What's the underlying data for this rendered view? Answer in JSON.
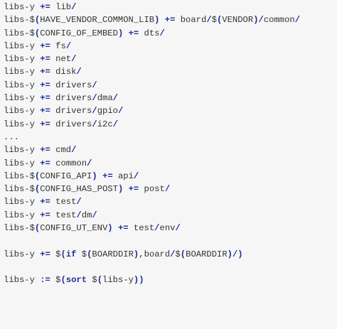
{
  "editor": {
    "lines": [
      {
        "tokens": [
          {
            "t": "libs-y ",
            "c": "tx"
          },
          {
            "t": "+=",
            "c": "op"
          },
          {
            "t": " lib",
            "c": "tx"
          },
          {
            "t": "/",
            "c": "sl"
          }
        ]
      },
      {
        "tokens": [
          {
            "t": "libs-$",
            "c": "tx"
          },
          {
            "t": "(",
            "c": "kw"
          },
          {
            "t": "HAVE_VENDOR_COMMON_LIB",
            "c": "tx"
          },
          {
            "t": ")",
            "c": "kw"
          },
          {
            "t": " ",
            "c": "tx"
          },
          {
            "t": "+=",
            "c": "op"
          },
          {
            "t": " board",
            "c": "tx"
          },
          {
            "t": "/",
            "c": "sl"
          },
          {
            "t": "$",
            "c": "tx"
          },
          {
            "t": "(",
            "c": "kw"
          },
          {
            "t": "VENDOR",
            "c": "tx"
          },
          {
            "t": ")",
            "c": "kw"
          },
          {
            "t": "/",
            "c": "sl"
          },
          {
            "t": "common",
            "c": "tx"
          },
          {
            "t": "/",
            "c": "sl"
          }
        ]
      },
      {
        "tokens": [
          {
            "t": "libs-$",
            "c": "tx"
          },
          {
            "t": "(",
            "c": "kw"
          },
          {
            "t": "CONFIG_OF_EMBED",
            "c": "tx"
          },
          {
            "t": ")",
            "c": "kw"
          },
          {
            "t": " ",
            "c": "tx"
          },
          {
            "t": "+=",
            "c": "op"
          },
          {
            "t": " dts",
            "c": "tx"
          },
          {
            "t": "/",
            "c": "sl"
          }
        ]
      },
      {
        "tokens": [
          {
            "t": "libs-y ",
            "c": "tx"
          },
          {
            "t": "+=",
            "c": "op"
          },
          {
            "t": " fs",
            "c": "tx"
          },
          {
            "t": "/",
            "c": "sl"
          }
        ]
      },
      {
        "tokens": [
          {
            "t": "libs-y ",
            "c": "tx"
          },
          {
            "t": "+=",
            "c": "op"
          },
          {
            "t": " net",
            "c": "tx"
          },
          {
            "t": "/",
            "c": "sl"
          }
        ]
      },
      {
        "tokens": [
          {
            "t": "libs-y ",
            "c": "tx"
          },
          {
            "t": "+=",
            "c": "op"
          },
          {
            "t": " disk",
            "c": "tx"
          },
          {
            "t": "/",
            "c": "sl"
          }
        ]
      },
      {
        "tokens": [
          {
            "t": "libs-y ",
            "c": "tx"
          },
          {
            "t": "+=",
            "c": "op"
          },
          {
            "t": " drivers",
            "c": "tx"
          },
          {
            "t": "/",
            "c": "sl"
          }
        ]
      },
      {
        "tokens": [
          {
            "t": "libs-y ",
            "c": "tx"
          },
          {
            "t": "+=",
            "c": "op"
          },
          {
            "t": " drivers",
            "c": "tx"
          },
          {
            "t": "/",
            "c": "sl"
          },
          {
            "t": "dma",
            "c": "tx"
          },
          {
            "t": "/",
            "c": "sl"
          }
        ]
      },
      {
        "tokens": [
          {
            "t": "libs-y ",
            "c": "tx"
          },
          {
            "t": "+=",
            "c": "op"
          },
          {
            "t": " drivers",
            "c": "tx"
          },
          {
            "t": "/",
            "c": "sl"
          },
          {
            "t": "gpio",
            "c": "tx"
          },
          {
            "t": "/",
            "c": "sl"
          }
        ]
      },
      {
        "tokens": [
          {
            "t": "libs-y ",
            "c": "tx"
          },
          {
            "t": "+=",
            "c": "op"
          },
          {
            "t": " drivers",
            "c": "tx"
          },
          {
            "t": "/",
            "c": "sl"
          },
          {
            "t": "i2c",
            "c": "tx"
          },
          {
            "t": "/",
            "c": "sl"
          }
        ]
      },
      {
        "kind": "ellipsis",
        "tokens": [
          {
            "t": "...",
            "c": "dl"
          }
        ]
      },
      {
        "tokens": [
          {
            "t": "libs-y ",
            "c": "tx"
          },
          {
            "t": "+=",
            "c": "op"
          },
          {
            "t": " cmd",
            "c": "tx"
          },
          {
            "t": "/",
            "c": "sl"
          }
        ]
      },
      {
        "tokens": [
          {
            "t": "libs-y ",
            "c": "tx"
          },
          {
            "t": "+=",
            "c": "op"
          },
          {
            "t": " common",
            "c": "tx"
          },
          {
            "t": "/",
            "c": "sl"
          }
        ]
      },
      {
        "tokens": [
          {
            "t": "libs-$",
            "c": "tx"
          },
          {
            "t": "(",
            "c": "kw"
          },
          {
            "t": "CONFIG_API",
            "c": "tx"
          },
          {
            "t": ")",
            "c": "kw"
          },
          {
            "t": " ",
            "c": "tx"
          },
          {
            "t": "+=",
            "c": "op"
          },
          {
            "t": " api",
            "c": "tx"
          },
          {
            "t": "/",
            "c": "sl"
          }
        ]
      },
      {
        "tokens": [
          {
            "t": "libs-$",
            "c": "tx"
          },
          {
            "t": "(",
            "c": "kw"
          },
          {
            "t": "CONFIG_HAS_POST",
            "c": "tx"
          },
          {
            "t": ")",
            "c": "kw"
          },
          {
            "t": " ",
            "c": "tx"
          },
          {
            "t": "+=",
            "c": "op"
          },
          {
            "t": " post",
            "c": "tx"
          },
          {
            "t": "/",
            "c": "sl"
          }
        ]
      },
      {
        "tokens": [
          {
            "t": "libs-y ",
            "c": "tx"
          },
          {
            "t": "+=",
            "c": "op"
          },
          {
            "t": " test",
            "c": "tx"
          },
          {
            "t": "/",
            "c": "sl"
          }
        ]
      },
      {
        "tokens": [
          {
            "t": "libs-y ",
            "c": "tx"
          },
          {
            "t": "+=",
            "c": "op"
          },
          {
            "t": " test",
            "c": "tx"
          },
          {
            "t": "/",
            "c": "sl"
          },
          {
            "t": "dm",
            "c": "tx"
          },
          {
            "t": "/",
            "c": "sl"
          }
        ]
      },
      {
        "tokens": [
          {
            "t": "libs-$",
            "c": "tx"
          },
          {
            "t": "(",
            "c": "kw"
          },
          {
            "t": "CONFIG_UT_ENV",
            "c": "tx"
          },
          {
            "t": ")",
            "c": "kw"
          },
          {
            "t": " ",
            "c": "tx"
          },
          {
            "t": "+=",
            "c": "op"
          },
          {
            "t": " test",
            "c": "tx"
          },
          {
            "t": "/",
            "c": "sl"
          },
          {
            "t": "env",
            "c": "tx"
          },
          {
            "t": "/",
            "c": "sl"
          }
        ]
      },
      {
        "kind": "blank",
        "tokens": []
      },
      {
        "tokens": [
          {
            "t": "libs-y ",
            "c": "tx"
          },
          {
            "t": "+=",
            "c": "op"
          },
          {
            "t": " $",
            "c": "tx"
          },
          {
            "t": "(if",
            "c": "kw"
          },
          {
            "t": " $",
            "c": "tx"
          },
          {
            "t": "(",
            "c": "kw"
          },
          {
            "t": "BOARDDIR",
            "c": "tx"
          },
          {
            "t": ")",
            "c": "kw"
          },
          {
            "t": ",board",
            "c": "tx"
          },
          {
            "t": "/",
            "c": "sl"
          },
          {
            "t": "$",
            "c": "tx"
          },
          {
            "t": "(",
            "c": "kw"
          },
          {
            "t": "BOARDDIR",
            "c": "tx"
          },
          {
            "t": ")/)",
            "c": "kw"
          }
        ]
      },
      {
        "kind": "blank",
        "tokens": []
      },
      {
        "tokens": [
          {
            "t": "libs-y ",
            "c": "tx"
          },
          {
            "t": ":=",
            "c": "op"
          },
          {
            "t": " $",
            "c": "tx"
          },
          {
            "t": "(sort",
            "c": "kw"
          },
          {
            "t": " $",
            "c": "tx"
          },
          {
            "t": "(",
            "c": "kw"
          },
          {
            "t": "libs-y",
            "c": "tx"
          },
          {
            "t": "))",
            "c": "kw"
          }
        ]
      }
    ]
  },
  "colors": {
    "background": "#f6f6f6",
    "text": "#333333",
    "keyword": "#1d2f96"
  }
}
